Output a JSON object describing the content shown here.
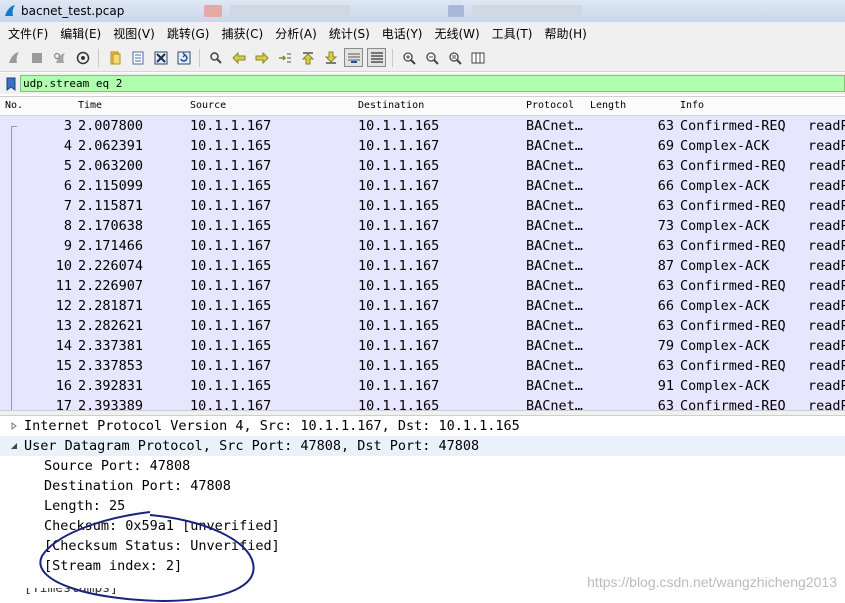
{
  "window": {
    "title": "bacnet_test.pcap"
  },
  "menu": [
    "文件(F)",
    "编辑(E)",
    "视图(V)",
    "跳转(G)",
    "捕获(C)",
    "分析(A)",
    "统计(S)",
    "电话(Y)",
    "无线(W)",
    "工具(T)",
    "帮助(H)"
  ],
  "toolbar": {
    "icons": [
      "start-capture-icon",
      "stop-capture-icon",
      "restart-capture-icon",
      "capture-options-icon",
      "open-file-icon",
      "save-file-icon",
      "close-file-icon",
      "reload-file-icon",
      "find-packet-icon",
      "go-back-icon",
      "go-forward-icon",
      "go-to-packet-icon",
      "go-first-icon",
      "go-last-icon",
      "auto-scroll-icon",
      "colorize-icon",
      "zoom-in-icon",
      "zoom-out-icon",
      "normal-size-icon",
      "resize-columns-icon"
    ]
  },
  "filter": {
    "value": "udp.stream eq 2"
  },
  "packet_list": {
    "columns": [
      "No.",
      "Time",
      "Source",
      "Destination",
      "Protocol",
      "Length",
      "Info"
    ],
    "rows": [
      {
        "no": "3",
        "time": "2.007800",
        "src": "10.1.1.167",
        "dst": "10.1.1.165",
        "proto": "BACnet…",
        "len": "63",
        "info": "Confirmed-REQ",
        "extra": "readP"
      },
      {
        "no": "4",
        "time": "2.062391",
        "src": "10.1.1.165",
        "dst": "10.1.1.167",
        "proto": "BACnet…",
        "len": "69",
        "info": "Complex-ACK",
        "extra": "readP"
      },
      {
        "no": "5",
        "time": "2.063200",
        "src": "10.1.1.167",
        "dst": "10.1.1.165",
        "proto": "BACnet…",
        "len": "63",
        "info": "Confirmed-REQ",
        "extra": "readP"
      },
      {
        "no": "6",
        "time": "2.115099",
        "src": "10.1.1.165",
        "dst": "10.1.1.167",
        "proto": "BACnet…",
        "len": "66",
        "info": "Complex-ACK",
        "extra": "readP"
      },
      {
        "no": "7",
        "time": "2.115871",
        "src": "10.1.1.167",
        "dst": "10.1.1.165",
        "proto": "BACnet…",
        "len": "63",
        "info": "Confirmed-REQ",
        "extra": "readP"
      },
      {
        "no": "8",
        "time": "2.170638",
        "src": "10.1.1.165",
        "dst": "10.1.1.167",
        "proto": "BACnet…",
        "len": "73",
        "info": "Complex-ACK",
        "extra": "readP"
      },
      {
        "no": "9",
        "time": "2.171466",
        "src": "10.1.1.167",
        "dst": "10.1.1.165",
        "proto": "BACnet…",
        "len": "63",
        "info": "Confirmed-REQ",
        "extra": "readP"
      },
      {
        "no": "10",
        "time": "2.226074",
        "src": "10.1.1.165",
        "dst": "10.1.1.167",
        "proto": "BACnet…",
        "len": "87",
        "info": "Complex-ACK",
        "extra": "readP"
      },
      {
        "no": "11",
        "time": "2.226907",
        "src": "10.1.1.167",
        "dst": "10.1.1.165",
        "proto": "BACnet…",
        "len": "63",
        "info": "Confirmed-REQ",
        "extra": "readP"
      },
      {
        "no": "12",
        "time": "2.281871",
        "src": "10.1.1.165",
        "dst": "10.1.1.167",
        "proto": "BACnet…",
        "len": "66",
        "info": "Complex-ACK",
        "extra": "readP"
      },
      {
        "no": "13",
        "time": "2.282621",
        "src": "10.1.1.167",
        "dst": "10.1.1.165",
        "proto": "BACnet…",
        "len": "63",
        "info": "Confirmed-REQ",
        "extra": "readP"
      },
      {
        "no": "14",
        "time": "2.337381",
        "src": "10.1.1.165",
        "dst": "10.1.1.167",
        "proto": "BACnet…",
        "len": "79",
        "info": "Complex-ACK",
        "extra": "readP"
      },
      {
        "no": "15",
        "time": "2.337853",
        "src": "10.1.1.167",
        "dst": "10.1.1.165",
        "proto": "BACnet…",
        "len": "63",
        "info": "Confirmed-REQ",
        "extra": "readP"
      },
      {
        "no": "16",
        "time": "2.392831",
        "src": "10.1.1.165",
        "dst": "10.1.1.167",
        "proto": "BACnet…",
        "len": "91",
        "info": "Complex-ACK",
        "extra": "readP"
      },
      {
        "no": "17",
        "time": "2.393389",
        "src": "10.1.1.167",
        "dst": "10.1.1.165",
        "proto": "BACnet…",
        "len": "63",
        "info": "Confirmed-REQ",
        "extra": "readP"
      }
    ]
  },
  "details": [
    {
      "text": "Internet Protocol Version 4, Src: 10.1.1.167, Dst: 10.1.1.165",
      "level": 0,
      "expander": "collapsed"
    },
    {
      "text": "User Datagram Protocol, Src Port: 47808, Dst Port: 47808",
      "level": 0,
      "expander": "expanded"
    },
    {
      "text": "Source Port: 47808",
      "level": 1
    },
    {
      "text": "Destination Port: 47808",
      "level": 1
    },
    {
      "text": "Length: 25",
      "level": 1
    },
    {
      "text": "Checksum: 0x59a1 [unverified]",
      "level": 1
    },
    {
      "text": "[Checksum Status: Unverified]",
      "level": 1
    },
    {
      "text": "[Stream index: 2]",
      "level": 1
    }
  ],
  "details_partial_row": "[Timestamps]",
  "watermark": "https://blog.csdn.net/wangzhicheng2013",
  "colors": {
    "row_bg": "#e7e6ff",
    "filter_valid": "#afffaf",
    "annotation": "#1a237e"
  }
}
